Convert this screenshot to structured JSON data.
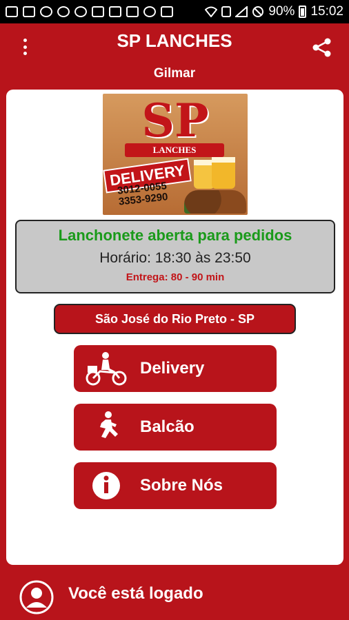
{
  "status_bar": {
    "battery": "90%",
    "time": "15:02",
    "left_icons": [
      "chat-icon",
      "facebook-icon",
      "hat-icon",
      "whatsapp-icon",
      "phone-icon",
      "image-icon",
      "mail-icon",
      "clipboard-icon",
      "at-icon",
      "bookmark-icon"
    ],
    "right_icons": [
      "wifi-icon",
      "sim-icon",
      "signal-icon",
      "do-not-disturb-icon",
      "battery-icon"
    ]
  },
  "header": {
    "title": "SP LANCHES",
    "user": "Gilmar",
    "menu_icon": "overflow-menu-icon",
    "share_icon": "share-icon"
  },
  "logo": {
    "brand": "SP",
    "banner": "LANCHES",
    "badge": "DELIVERY",
    "phone1": "3012-0055",
    "phone2": "3353-9290"
  },
  "status": {
    "open": "Lanchonete aberta para pedidos",
    "hours": "Horário: 18:30 às 23:50",
    "eta": "Entrega: 80 - 90 min"
  },
  "city": "São José do Rio Preto - SP",
  "actions": [
    {
      "label": "Delivery",
      "icon": "motorcycle-icon"
    },
    {
      "label": "Balcão",
      "icon": "walking-icon"
    },
    {
      "label": "Sobre Nós",
      "icon": "info-icon"
    }
  ],
  "footer": {
    "text": "Você está logado",
    "icon": "user-avatar-icon"
  },
  "colors": {
    "brand_red": "#b8141b",
    "open_green": "#1a9a1a",
    "status_bg": "#c8c8c8"
  }
}
